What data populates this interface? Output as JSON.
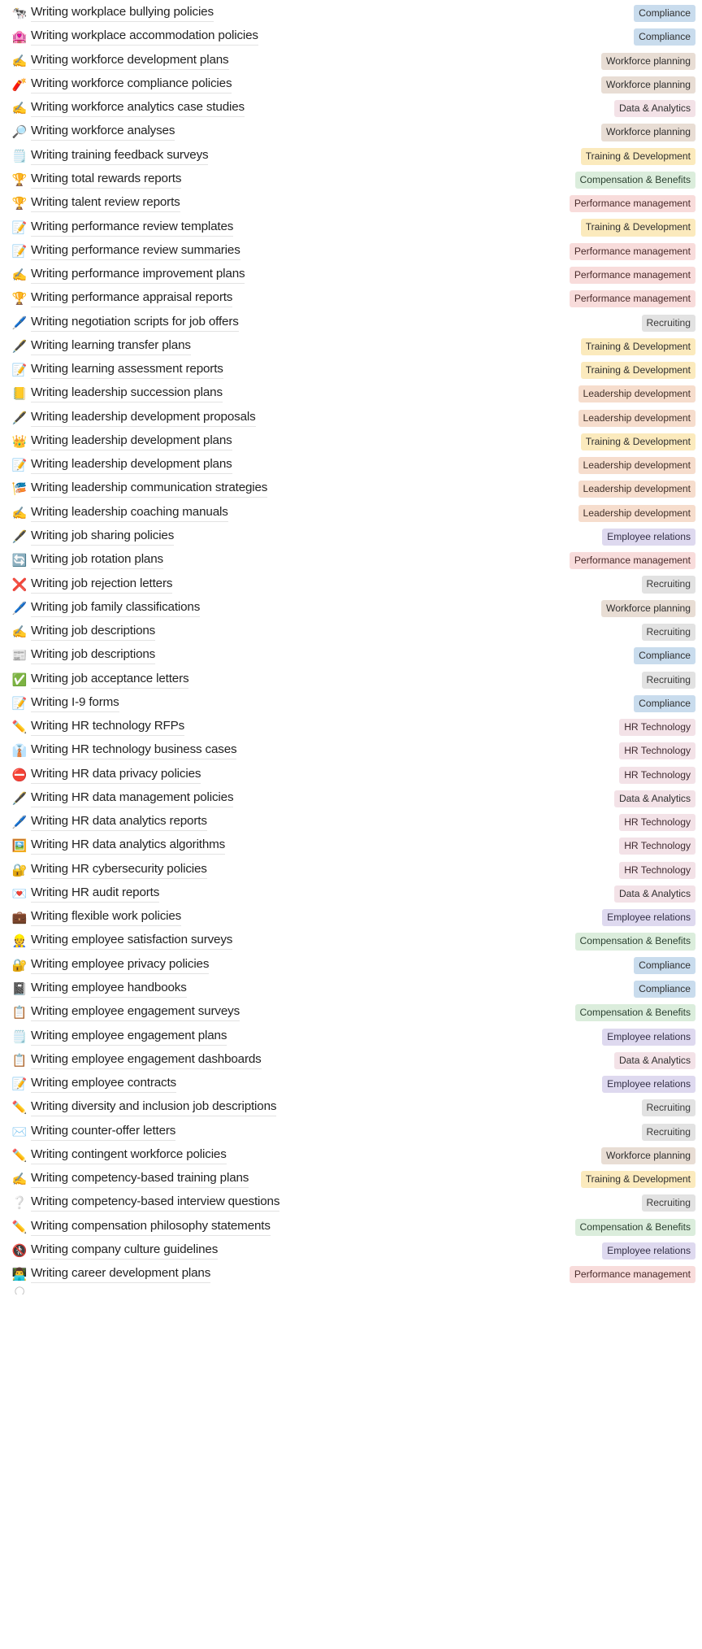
{
  "view": {
    "type": "search-results-list",
    "tag_colors": {
      "Compliance": "#c9dced",
      "Workforce planning": "#e8ddd4",
      "Data & Analytics": "#f3e2e7",
      "Training & Development": "#fbeabd",
      "Compensation & Benefits": "#dbeddc",
      "Performance management": "#f8dcdb",
      "Recruiting": "#e2e2e2",
      "Leadership development": "#f6ddcd",
      "Employee relations": "#ded9ef",
      "HR Technology": "#f3e2e7"
    }
  },
  "rows": [
    {
      "icon": "🐄",
      "icon_name": "cow-icon",
      "label": "Writing workplace bullying policies",
      "tag": "Compliance",
      "tag_class": "t-compliance"
    },
    {
      "icon": "🏩",
      "icon_name": "love-hotel-icon",
      "label": "Writing workplace accommodation policies",
      "tag": "Compliance",
      "tag_class": "t-compliance"
    },
    {
      "icon": "✍️",
      "icon_name": "writing-hand-icon",
      "label": "Writing workforce development plans",
      "tag": "Workforce planning",
      "tag_class": "t-workforce-planning"
    },
    {
      "icon": "🧨",
      "icon_name": "firecracker-icon",
      "label": "Writing workforce compliance policies",
      "tag": "Workforce planning",
      "tag_class": "t-workforce-planning"
    },
    {
      "icon": "✍️",
      "icon_name": "writing-hand-icon",
      "label": "Writing workforce analytics case studies",
      "tag": "Data & Analytics",
      "tag_class": "t-data-analytics"
    },
    {
      "icon": "🔎",
      "icon_name": "magnifying-glass-icon",
      "label": "Writing workforce analyses",
      "tag": "Workforce planning",
      "tag_class": "t-workforce-planning"
    },
    {
      "icon": "🗒️",
      "icon_name": "spiral-notepad-icon",
      "label": "Writing training feedback surveys",
      "tag": "Training & Development",
      "tag_class": "t-training-dev"
    },
    {
      "icon": "🏆",
      "icon_name": "trophy-icon",
      "label": "Writing total rewards reports",
      "tag": "Compensation & Benefits",
      "tag_class": "t-compensation"
    },
    {
      "icon": "🏆",
      "icon_name": "trophy-icon",
      "label": "Writing talent review reports",
      "tag": "Performance management",
      "tag_class": "t-performance"
    },
    {
      "icon": "📝",
      "icon_name": "memo-icon",
      "label": "Writing performance review templates",
      "tag": "Training & Development",
      "tag_class": "t-training-dev"
    },
    {
      "icon": "📝",
      "icon_name": "memo-icon",
      "label": "Writing performance review summaries",
      "tag": "Performance management",
      "tag_class": "t-performance"
    },
    {
      "icon": "✍️",
      "icon_name": "writing-hand-icon",
      "label": "Writing performance improvement plans",
      "tag": "Performance management",
      "tag_class": "t-performance"
    },
    {
      "icon": "🏆",
      "icon_name": "trophy-icon",
      "label": "Writing performance appraisal reports",
      "tag": "Performance management",
      "tag_class": "t-performance"
    },
    {
      "icon": "🖊️",
      "icon_name": "pen-icon",
      "label": "Writing negotiation scripts for job offers",
      "tag": "Recruiting",
      "tag_class": "t-recruiting"
    },
    {
      "icon": "🖋️",
      "icon_name": "fountain-pen-icon",
      "label": "Writing learning transfer plans",
      "tag": "Training & Development",
      "tag_class": "t-training-dev"
    },
    {
      "icon": "📝",
      "icon_name": "memo-icon",
      "label": "Writing learning assessment reports",
      "tag": "Training & Development",
      "tag_class": "t-training-dev"
    },
    {
      "icon": "📒",
      "icon_name": "ledger-icon",
      "label": "Writing leadership succession plans",
      "tag": "Leadership development",
      "tag_class": "t-leadership"
    },
    {
      "icon": "🖋️",
      "icon_name": "fountain-pen-icon",
      "label": "Writing leadership development proposals",
      "tag": "Leadership development",
      "tag_class": "t-leadership"
    },
    {
      "icon": "👑",
      "icon_name": "crown-icon",
      "label": "Writing leadership development plans",
      "tag": "Training & Development",
      "tag_class": "t-training-dev"
    },
    {
      "icon": "📝",
      "icon_name": "memo-icon",
      "label": "Writing leadership development plans",
      "tag": "Leadership development",
      "tag_class": "t-leadership"
    },
    {
      "icon": "🎏",
      "icon_name": "crossed-flags-icon",
      "label": "Writing leadership communication strategies",
      "tag": "Leadership development",
      "tag_class": "t-leadership"
    },
    {
      "icon": "✍️",
      "icon_name": "writing-hand-icon",
      "label": "Writing leadership coaching manuals",
      "tag": "Leadership development",
      "tag_class": "t-leadership"
    },
    {
      "icon": "🖋️",
      "icon_name": "fountain-pen-icon",
      "label": "Writing job sharing policies",
      "tag": "Employee relations",
      "tag_class": "t-employee-relations"
    },
    {
      "icon": "🔄",
      "icon_name": "refresh-cycle-icon",
      "label": "Writing job rotation plans",
      "tag": "Performance management",
      "tag_class": "t-performance"
    },
    {
      "icon": "❌",
      "icon_name": "cross-mark-icon",
      "label": "Writing job rejection letters",
      "tag": "Recruiting",
      "tag_class": "t-recruiting"
    },
    {
      "icon": "🖊️",
      "icon_name": "pen-icon",
      "label": "Writing job family classifications",
      "tag": "Workforce planning",
      "tag_class": "t-workforce-planning"
    },
    {
      "icon": "✍️",
      "icon_name": "writing-hand-icon",
      "label": "Writing job descriptions",
      "tag": "Recruiting",
      "tag_class": "t-recruiting"
    },
    {
      "icon": "📰",
      "icon_name": "newspaper-icon",
      "label": "Writing job descriptions",
      "tag": "Compliance",
      "tag_class": "t-compliance"
    },
    {
      "icon": "✅",
      "icon_name": "check-mark-icon",
      "label": "Writing job acceptance letters",
      "tag": "Recruiting",
      "tag_class": "t-recruiting"
    },
    {
      "icon": "📝",
      "icon_name": "memo-icon",
      "label": "Writing I-9 forms",
      "tag": "Compliance",
      "tag_class": "t-compliance"
    },
    {
      "icon": "✏️",
      "icon_name": "pencil-icon",
      "label": "Writing HR technology RFPs",
      "tag": "HR Technology",
      "tag_class": "t-hr-technology"
    },
    {
      "icon": "👔",
      "icon_name": "necktie-icon",
      "label": "Writing HR technology business cases",
      "tag": "HR Technology",
      "tag_class": "t-hr-technology"
    },
    {
      "icon": "⛔",
      "icon_name": "no-entry-icon",
      "label": "Writing HR data privacy policies",
      "tag": "HR Technology",
      "tag_class": "t-hr-technology"
    },
    {
      "icon": "🖋️",
      "icon_name": "fountain-pen-icon",
      "label": "Writing HR data management policies",
      "tag": "Data & Analytics",
      "tag_class": "t-data-analytics"
    },
    {
      "icon": "🖊️",
      "icon_name": "pen-icon",
      "label": "Writing HR data analytics reports",
      "tag": "HR Technology",
      "tag_class": "t-hr-technology"
    },
    {
      "icon": "🖼️",
      "icon_name": "framed-picture-icon",
      "label": "Writing HR data analytics algorithms",
      "tag": "HR Technology",
      "tag_class": "t-hr-technology"
    },
    {
      "icon": "🔐",
      "icon_name": "lock-with-key-icon",
      "label": "Writing HR cybersecurity policies",
      "tag": "HR Technology",
      "tag_class": "t-hr-technology"
    },
    {
      "icon": "💌",
      "icon_name": "love-letter-icon",
      "label": "Writing HR audit reports",
      "tag": "Data & Analytics",
      "tag_class": "t-data-analytics"
    },
    {
      "icon": "💼",
      "icon_name": "briefcase-icon",
      "label": "Writing flexible work policies",
      "tag": "Employee relations",
      "tag_class": "t-employee-relations"
    },
    {
      "icon": "👷",
      "icon_name": "construction-worker-icon",
      "label": "Writing employee satisfaction surveys",
      "tag": "Compensation & Benefits",
      "tag_class": "t-compensation"
    },
    {
      "icon": "🔐",
      "icon_name": "lock-with-key-icon",
      "label": "Writing employee privacy policies",
      "tag": "Compliance",
      "tag_class": "t-compliance"
    },
    {
      "icon": "📓",
      "icon_name": "notebook-icon",
      "label": "Writing employee handbooks",
      "tag": "Compliance",
      "tag_class": "t-compliance"
    },
    {
      "icon": "📋",
      "icon_name": "clipboard-icon",
      "label": "Writing employee engagement surveys",
      "tag": "Compensation & Benefits",
      "tag_class": "t-compensation"
    },
    {
      "icon": "🗒️",
      "icon_name": "spiral-notepad-icon",
      "label": "Writing employee engagement plans",
      "tag": "Employee relations",
      "tag_class": "t-employee-relations"
    },
    {
      "icon": "📋",
      "icon_name": "clipboard-icon",
      "label": "Writing employee engagement dashboards",
      "tag": "Data & Analytics",
      "tag_class": "t-data-analytics"
    },
    {
      "icon": "📝",
      "icon_name": "memo-icon",
      "label": "Writing employee contracts",
      "tag": "Employee relations",
      "tag_class": "t-employee-relations"
    },
    {
      "icon": "✏️",
      "icon_name": "pencil-icon",
      "label": "Writing diversity and inclusion job descriptions",
      "tag": "Recruiting",
      "tag_class": "t-recruiting"
    },
    {
      "icon": "✉️",
      "icon_name": "envelope-icon",
      "label": "Writing counter-offer letters",
      "tag": "Recruiting",
      "tag_class": "t-recruiting"
    },
    {
      "icon": "✏️",
      "icon_name": "pencil-icon",
      "label": "Writing contingent workforce policies",
      "tag": "Workforce planning",
      "tag_class": "t-workforce-planning"
    },
    {
      "icon": "✍️",
      "icon_name": "writing-hand-icon",
      "label": "Writing competency-based training plans",
      "tag": "Training & Development",
      "tag_class": "t-training-dev"
    },
    {
      "icon": "❔",
      "icon_name": "question-mark-icon",
      "label": "Writing competency-based interview questions",
      "tag": "Recruiting",
      "tag_class": "t-recruiting"
    },
    {
      "icon": "✏️",
      "icon_name": "pencil-icon",
      "label": "Writing compensation philosophy statements",
      "tag": "Compensation & Benefits",
      "tag_class": "t-compensation"
    },
    {
      "icon": "🚷",
      "icon_name": "no-pedestrians-icon",
      "label": "Writing company culture guidelines",
      "tag": "Employee relations",
      "tag_class": "t-employee-relations"
    },
    {
      "icon": "👨‍💻",
      "icon_name": "technologist-icon",
      "label": "Writing career development plans",
      "tag": "Performance management",
      "tag_class": "t-performance"
    }
  ]
}
